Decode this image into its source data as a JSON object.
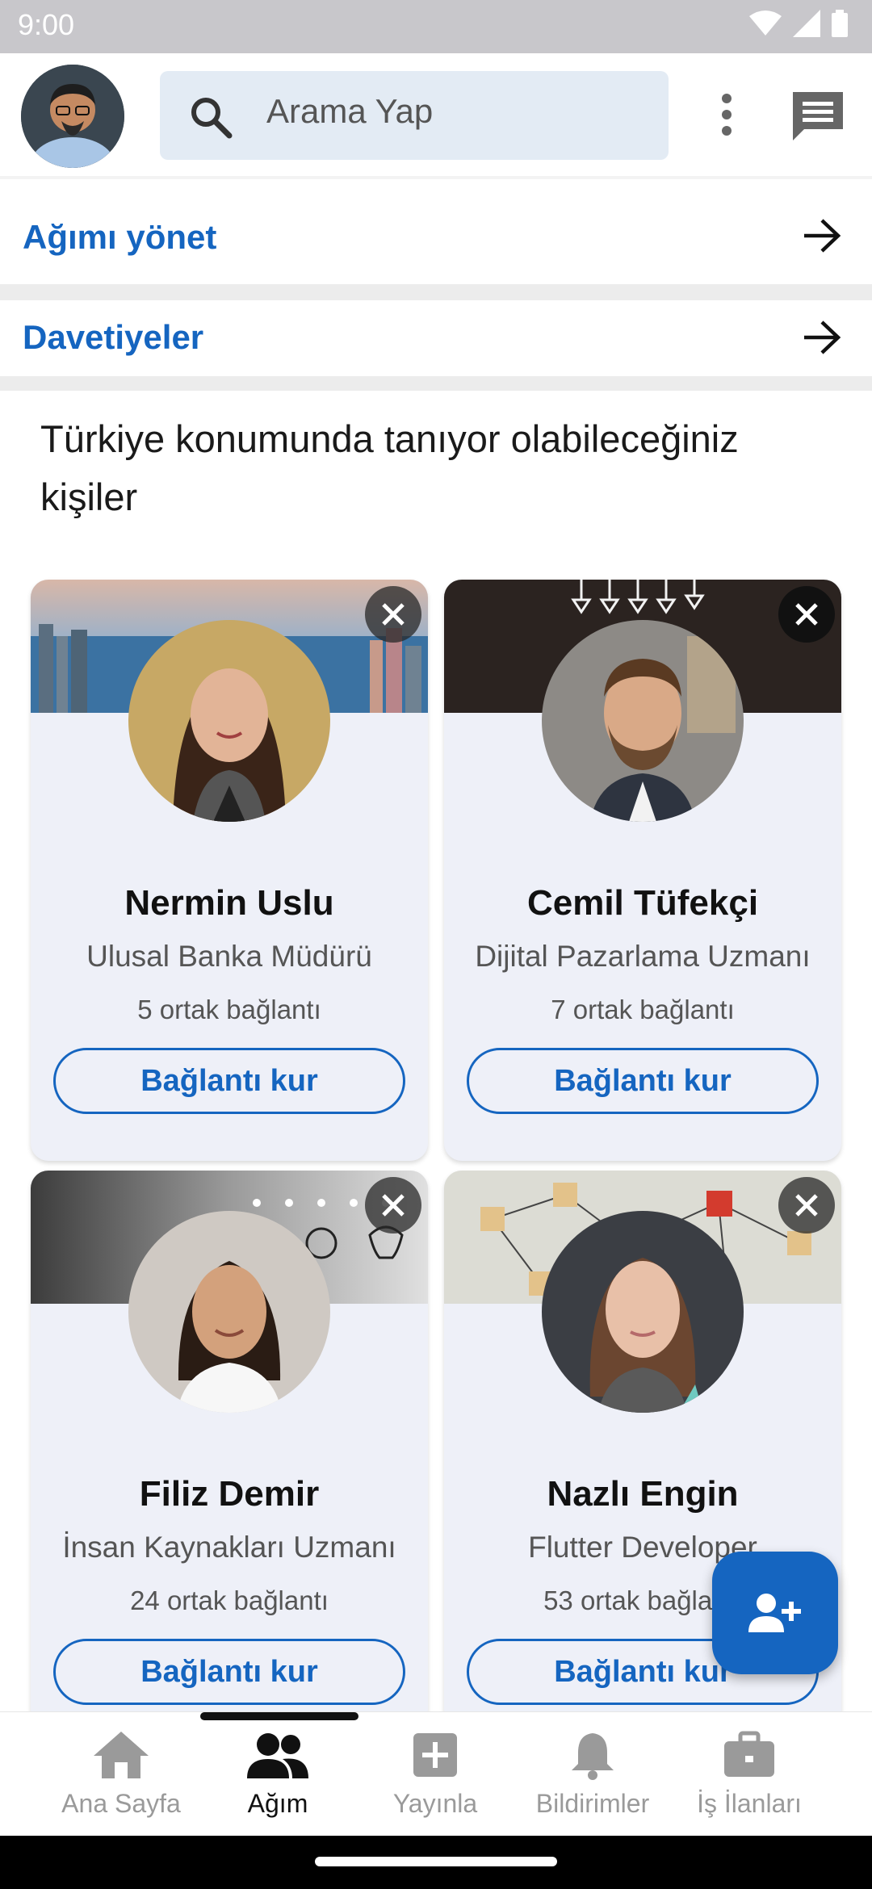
{
  "status": {
    "time": "9:00"
  },
  "search": {
    "placeholder": "Arama Yap"
  },
  "links": {
    "manage_network": "Ağımı yönet",
    "invitations": "Davetiyeler"
  },
  "section_title": "Türkiye konumunda tanıyor olabileceğiniz kişiler",
  "people": [
    {
      "name": "Nermin Uslu",
      "title": "Ulusal Banka Müdürü",
      "mutual": "5 ortak bağlantı",
      "button": "Bağlantı kur"
    },
    {
      "name": "Cemil Tüfekçi",
      "title": "Dijital Pazarlama Uzmanı",
      "mutual": "7 ortak bağlantı",
      "button": "Bağlantı kur"
    },
    {
      "name": "Filiz Demir",
      "title": "İnsan Kaynakları Uzmanı",
      "mutual": "24 ortak bağlantı",
      "button": "Bağlantı kur"
    },
    {
      "name": "Nazlı Engin",
      "title": "Flutter Developer",
      "mutual": "53 ortak bağlantı",
      "button": "Bağlantı kur"
    }
  ],
  "bottom_nav": [
    {
      "label": "Ana Sayfa",
      "icon": "home-icon"
    },
    {
      "label": "Ağım",
      "icon": "people-icon",
      "active": true
    },
    {
      "label": "Yayınla",
      "icon": "add-box-icon"
    },
    {
      "label": "Bildirimler",
      "icon": "bell-icon"
    },
    {
      "label": "İş İlanları",
      "icon": "briefcase-icon"
    }
  ],
  "colors": {
    "accent": "#1565c0",
    "search_bg": "#e3ebf4",
    "card_bg": "#eef0f8"
  }
}
